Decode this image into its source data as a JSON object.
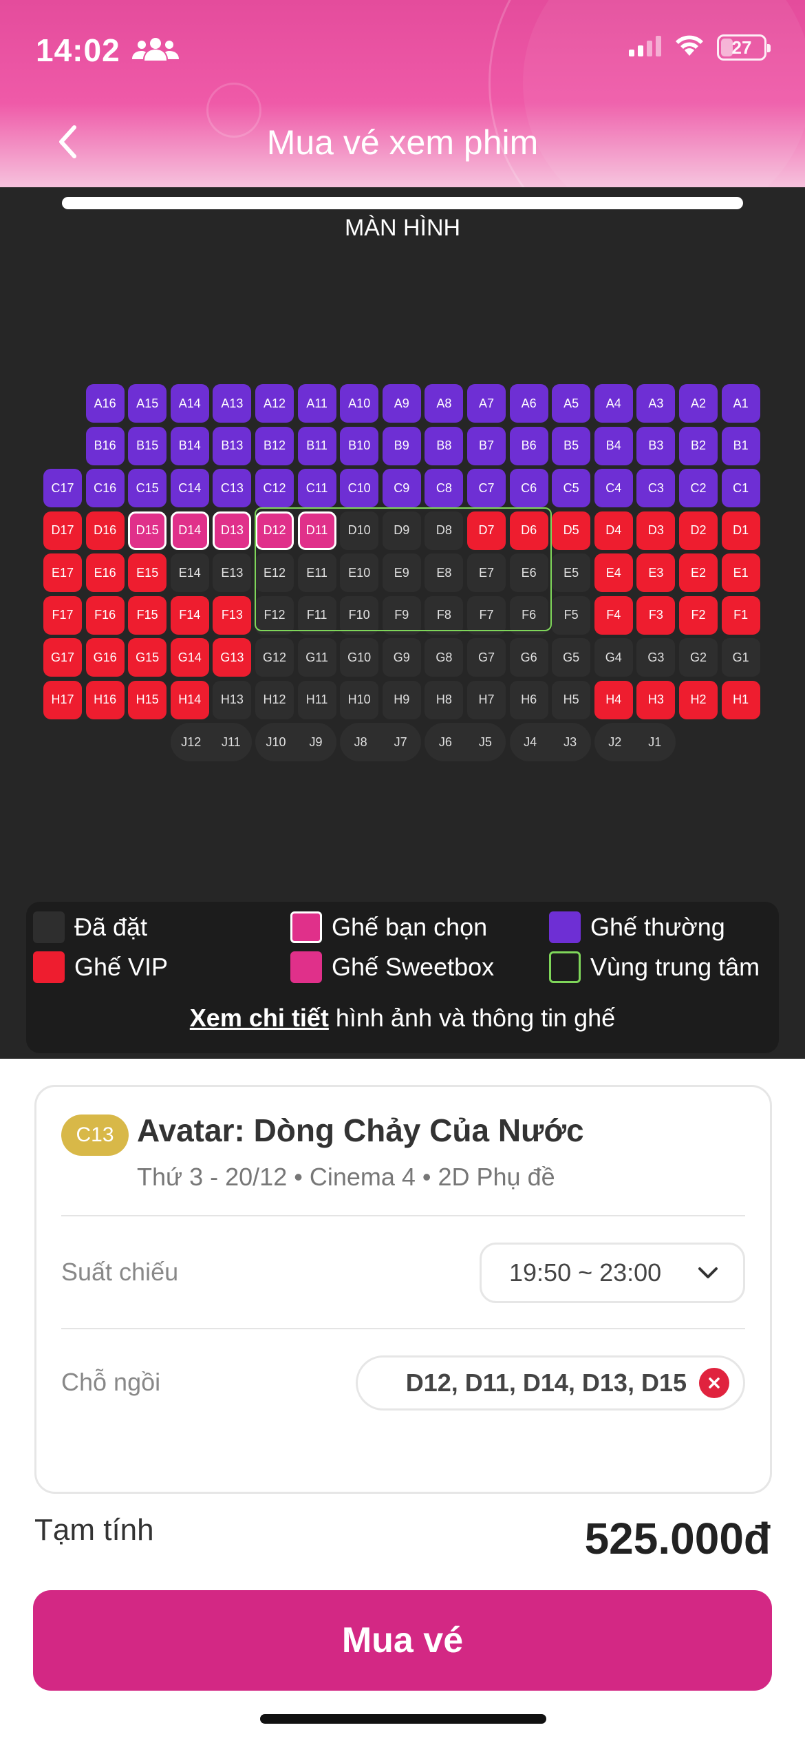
{
  "status_bar": {
    "time": "14:02",
    "battery": "27"
  },
  "header": {
    "title": "Mua vé xem phim"
  },
  "screen_label": "MÀN HÌNH",
  "rows": [
    {
      "row": "A",
      "seats": [
        {
          "id": "A16",
          "type": "normal"
        },
        {
          "id": "A15",
          "type": "normal"
        },
        {
          "id": "A14",
          "type": "normal"
        },
        {
          "id": "A13",
          "type": "normal"
        },
        {
          "id": "A12",
          "type": "normal"
        },
        {
          "id": "A11",
          "type": "normal"
        },
        {
          "id": "A10",
          "type": "normal"
        },
        {
          "id": "A9",
          "type": "normal"
        },
        {
          "id": "A8",
          "type": "normal"
        },
        {
          "id": "A7",
          "type": "normal"
        },
        {
          "id": "A6",
          "type": "normal"
        },
        {
          "id": "A5",
          "type": "normal"
        },
        {
          "id": "A4",
          "type": "normal"
        },
        {
          "id": "A3",
          "type": "normal"
        },
        {
          "id": "A2",
          "type": "normal"
        },
        {
          "id": "A1",
          "type": "normal"
        }
      ]
    },
    {
      "row": "B",
      "seats": [
        {
          "id": "B16",
          "type": "normal"
        },
        {
          "id": "B15",
          "type": "normal"
        },
        {
          "id": "B14",
          "type": "normal"
        },
        {
          "id": "B13",
          "type": "normal"
        },
        {
          "id": "B12",
          "type": "normal"
        },
        {
          "id": "B11",
          "type": "normal"
        },
        {
          "id": "B10",
          "type": "normal"
        },
        {
          "id": "B9",
          "type": "normal"
        },
        {
          "id": "B8",
          "type": "normal"
        },
        {
          "id": "B7",
          "type": "normal"
        },
        {
          "id": "B6",
          "type": "normal"
        },
        {
          "id": "B5",
          "type": "normal"
        },
        {
          "id": "B4",
          "type": "normal"
        },
        {
          "id": "B3",
          "type": "normal"
        },
        {
          "id": "B2",
          "type": "normal"
        },
        {
          "id": "B1",
          "type": "normal"
        }
      ]
    },
    {
      "row": "C",
      "seats": [
        {
          "id": "C17",
          "type": "normal"
        },
        {
          "id": "C16",
          "type": "normal"
        },
        {
          "id": "C15",
          "type": "normal"
        },
        {
          "id": "C14",
          "type": "normal"
        },
        {
          "id": "C13",
          "type": "normal"
        },
        {
          "id": "C12",
          "type": "normal"
        },
        {
          "id": "C11",
          "type": "normal"
        },
        {
          "id": "C10",
          "type": "normal"
        },
        {
          "id": "C9",
          "type": "normal"
        },
        {
          "id": "C8",
          "type": "normal"
        },
        {
          "id": "C7",
          "type": "normal"
        },
        {
          "id": "C6",
          "type": "normal"
        },
        {
          "id": "C5",
          "type": "normal"
        },
        {
          "id": "C4",
          "type": "normal"
        },
        {
          "id": "C3",
          "type": "normal"
        },
        {
          "id": "C2",
          "type": "normal"
        },
        {
          "id": "C1",
          "type": "normal"
        }
      ]
    },
    {
      "row": "D",
      "seats": [
        {
          "id": "D17",
          "type": "vip"
        },
        {
          "id": "D16",
          "type": "vip"
        },
        {
          "id": "D15",
          "type": "selected"
        },
        {
          "id": "D14",
          "type": "selected"
        },
        {
          "id": "D13",
          "type": "selected"
        },
        {
          "id": "D12",
          "type": "selected"
        },
        {
          "id": "D11",
          "type": "selected"
        },
        {
          "id": "D10",
          "type": "booked"
        },
        {
          "id": "D9",
          "type": "booked"
        },
        {
          "id": "D8",
          "type": "booked"
        },
        {
          "id": "D7",
          "type": "vip"
        },
        {
          "id": "D6",
          "type": "vip"
        },
        {
          "id": "D5",
          "type": "vip"
        },
        {
          "id": "D4",
          "type": "vip"
        },
        {
          "id": "D3",
          "type": "vip"
        },
        {
          "id": "D2",
          "type": "vip"
        },
        {
          "id": "D1",
          "type": "vip"
        }
      ]
    },
    {
      "row": "E",
      "seats": [
        {
          "id": "E17",
          "type": "vip"
        },
        {
          "id": "E16",
          "type": "vip"
        },
        {
          "id": "E15",
          "type": "vip"
        },
        {
          "id": "E14",
          "type": "booked"
        },
        {
          "id": "E13",
          "type": "booked"
        },
        {
          "id": "E12",
          "type": "booked"
        },
        {
          "id": "E11",
          "type": "booked"
        },
        {
          "id": "E10",
          "type": "booked"
        },
        {
          "id": "E9",
          "type": "booked"
        },
        {
          "id": "E8",
          "type": "booked"
        },
        {
          "id": "E7",
          "type": "booked"
        },
        {
          "id": "E6",
          "type": "booked"
        },
        {
          "id": "E5",
          "type": "booked"
        },
        {
          "id": "E4",
          "type": "vip"
        },
        {
          "id": "E3",
          "type": "vip"
        },
        {
          "id": "E2",
          "type": "vip"
        },
        {
          "id": "E1",
          "type": "vip"
        }
      ]
    },
    {
      "row": "F",
      "seats": [
        {
          "id": "F17",
          "type": "vip"
        },
        {
          "id": "F16",
          "type": "vip"
        },
        {
          "id": "F15",
          "type": "vip"
        },
        {
          "id": "F14",
          "type": "vip"
        },
        {
          "id": "F13",
          "type": "vip"
        },
        {
          "id": "F12",
          "type": "booked"
        },
        {
          "id": "F11",
          "type": "booked"
        },
        {
          "id": "F10",
          "type": "booked"
        },
        {
          "id": "F9",
          "type": "booked"
        },
        {
          "id": "F8",
          "type": "booked"
        },
        {
          "id": "F7",
          "type": "booked"
        },
        {
          "id": "F6",
          "type": "booked"
        },
        {
          "id": "F5",
          "type": "booked"
        },
        {
          "id": "F4",
          "type": "vip"
        },
        {
          "id": "F3",
          "type": "vip"
        },
        {
          "id": "F2",
          "type": "vip"
        },
        {
          "id": "F1",
          "type": "vip"
        }
      ]
    },
    {
      "row": "G",
      "seats": [
        {
          "id": "G17",
          "type": "vip"
        },
        {
          "id": "G16",
          "type": "vip"
        },
        {
          "id": "G15",
          "type": "vip"
        },
        {
          "id": "G14",
          "type": "vip"
        },
        {
          "id": "G13",
          "type": "vip"
        },
        {
          "id": "G12",
          "type": "booked"
        },
        {
          "id": "G11",
          "type": "booked"
        },
        {
          "id": "G10",
          "type": "booked"
        },
        {
          "id": "G9",
          "type": "booked"
        },
        {
          "id": "G8",
          "type": "booked"
        },
        {
          "id": "G7",
          "type": "booked"
        },
        {
          "id": "G6",
          "type": "booked"
        },
        {
          "id": "G5",
          "type": "booked"
        },
        {
          "id": "G4",
          "type": "booked"
        },
        {
          "id": "G3",
          "type": "booked"
        },
        {
          "id": "G2",
          "type": "booked"
        },
        {
          "id": "G1",
          "type": "booked"
        }
      ]
    },
    {
      "row": "H",
      "seats": [
        {
          "id": "H17",
          "type": "vip"
        },
        {
          "id": "H16",
          "type": "vip"
        },
        {
          "id": "H15",
          "type": "vip"
        },
        {
          "id": "H14",
          "type": "vip"
        },
        {
          "id": "H13",
          "type": "booked"
        },
        {
          "id": "H12",
          "type": "booked"
        },
        {
          "id": "H11",
          "type": "booked"
        },
        {
          "id": "H10",
          "type": "booked"
        },
        {
          "id": "H9",
          "type": "booked"
        },
        {
          "id": "H8",
          "type": "booked"
        },
        {
          "id": "H7",
          "type": "booked"
        },
        {
          "id": "H6",
          "type": "booked"
        },
        {
          "id": "H5",
          "type": "booked"
        },
        {
          "id": "H4",
          "type": "vip"
        },
        {
          "id": "H3",
          "type": "vip"
        },
        {
          "id": "H2",
          "type": "vip"
        },
        {
          "id": "H1",
          "type": "vip"
        }
      ]
    },
    {
      "row": "J",
      "sweetbox": true,
      "seats": [
        {
          "id": "J12",
          "type": "sweet"
        },
        {
          "id": "J11",
          "type": "sweet"
        },
        {
          "id": "J10",
          "type": "sweet"
        },
        {
          "id": "J9",
          "type": "sweet"
        },
        {
          "id": "J8",
          "type": "sweet"
        },
        {
          "id": "J7",
          "type": "sweet"
        },
        {
          "id": "J6",
          "type": "sweet"
        },
        {
          "id": "J5",
          "type": "sweet"
        },
        {
          "id": "J4",
          "type": "sweet"
        },
        {
          "id": "J3",
          "type": "sweet"
        },
        {
          "id": "J2",
          "type": "sweet"
        },
        {
          "id": "J1",
          "type": "sweet"
        }
      ]
    }
  ],
  "legend": {
    "booked": "Đã đặt",
    "selected": "Ghế bạn chọn",
    "normal": "Ghế thường",
    "vip": "Ghế VIP",
    "sweetbox": "Ghế Sweetbox",
    "center": "Vùng trung tâm",
    "detail_link": "Xem chi tiết",
    "detail_text": " hình ảnh và thông tin ghế"
  },
  "colors": {
    "normal": "#6e2fd4",
    "vip": "#ee1d2f",
    "selected": "#e0308a",
    "booked": "#2e2e2e",
    "center": "#7fd65a",
    "accent": "#d32884"
  },
  "booking": {
    "rating": "C13",
    "movie_title": "Avatar: Dòng Chảy Của Nước",
    "movie_info": "Thứ 3 - 20/12 • Cinema 4 • 2D Phụ đề",
    "showtime_label": "Suất chiếu",
    "showtime_value": "19:50 ~ 23:00",
    "seats_label": "Chỗ ngồi",
    "seats_value": "D12, D11, D14, D13, D15",
    "subtotal_label": "Tạm tính",
    "subtotal_value": "525.000đ",
    "buy_label": "Mua vé"
  }
}
